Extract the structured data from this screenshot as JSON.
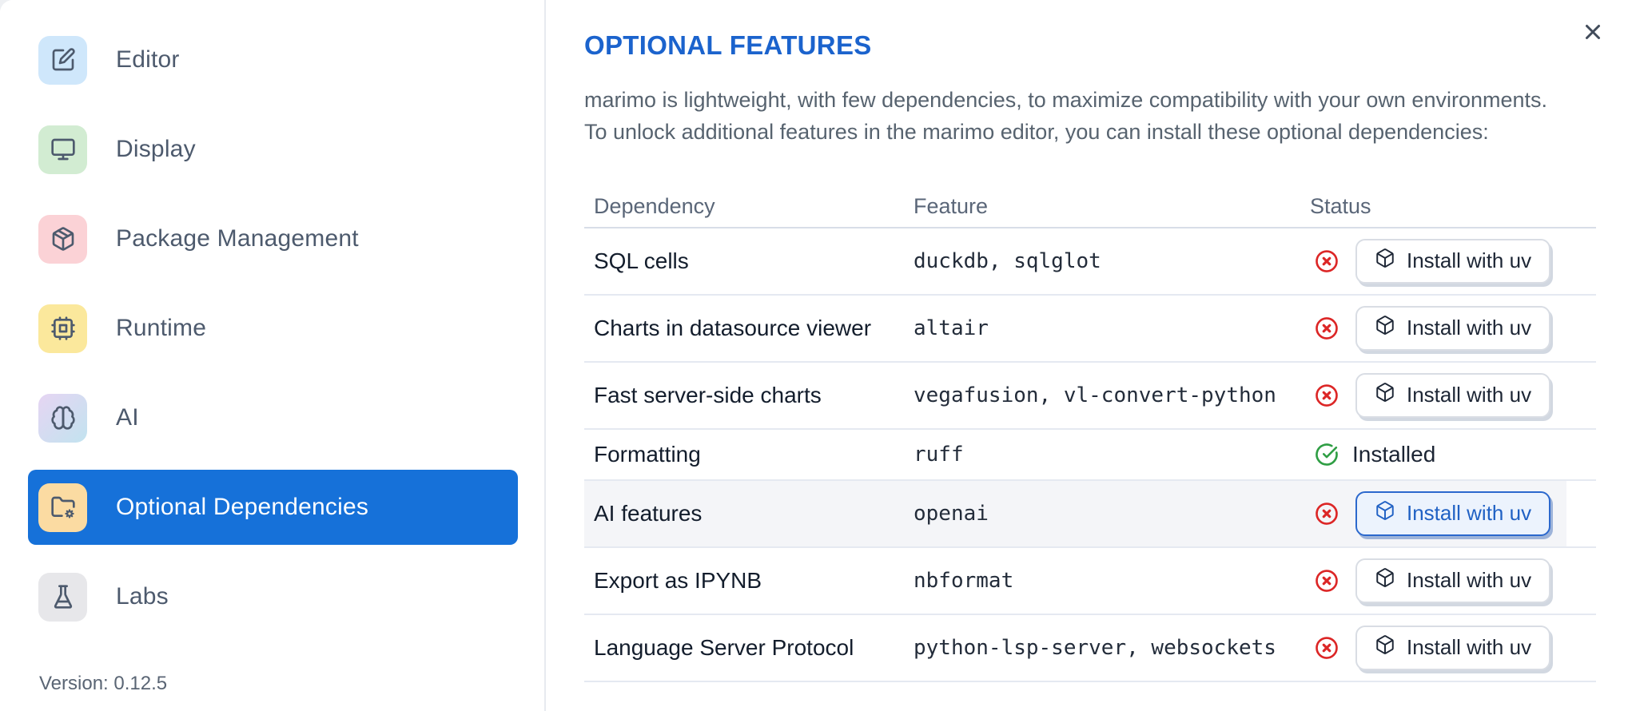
{
  "window": {
    "close_icon": "close-icon"
  },
  "sidebar": {
    "items": [
      {
        "label": "Editor",
        "icon": "edit-icon",
        "icon_bg": "#cfe7fb",
        "selected": false
      },
      {
        "label": "Display",
        "icon": "monitor-icon",
        "icon_bg": "#d2ecd2",
        "selected": false
      },
      {
        "label": "Package Management",
        "icon": "package-icon",
        "icon_bg": "#fbd2d6",
        "selected": false
      },
      {
        "label": "Runtime",
        "icon": "cpu-icon",
        "icon_bg": "#fbe89c",
        "selected": false
      },
      {
        "label": "AI",
        "icon": "brain-icon",
        "icon_bg": "linear-gradient(135deg,#e6d5f3,#c2e3ef)",
        "selected": false
      },
      {
        "label": "Optional Dependencies",
        "icon": "folder-cog-icon",
        "icon_bg": "#fbdba2",
        "selected": true
      },
      {
        "label": "Labs",
        "icon": "flask-icon",
        "icon_bg": "#e7e7ea",
        "selected": false
      }
    ],
    "version": "Version: 0.12.5"
  },
  "main": {
    "title": "OPTIONAL FEATURES",
    "description_line1": "marimo is lightweight, with few dependencies, to maximize compatibility with your own environments.",
    "description_line2": "To unlock additional features in the marimo editor, you can install these optional dependencies:",
    "table": {
      "headers": [
        "Dependency",
        "Feature",
        "Status"
      ],
      "install_button_label": "Install with uv",
      "installed_label": "Installed",
      "rows": [
        {
          "dependency": "SQL cells",
          "feature": "duckdb, sqlglot",
          "status": "not-installed",
          "action": "Install with uv",
          "highlighted": false
        },
        {
          "dependency": "Charts in datasource viewer",
          "feature": "altair",
          "status": "not-installed",
          "action": "Install with uv",
          "highlighted": false
        },
        {
          "dependency": "Fast server-side charts",
          "feature": "vegafusion, vl-convert-python",
          "status": "not-installed",
          "action": "Install with uv",
          "highlighted": false
        },
        {
          "dependency": "Formatting",
          "feature": "ruff",
          "status": "installed",
          "status_label": "Installed",
          "highlighted": false
        },
        {
          "dependency": "AI features",
          "feature": "openai",
          "status": "not-installed",
          "action": "Install with uv",
          "highlighted": true
        },
        {
          "dependency": "Export as IPYNB",
          "feature": "nbformat",
          "status": "not-installed",
          "action": "Install with uv",
          "highlighted": false
        },
        {
          "dependency": "Language Server Protocol",
          "feature": "python-lsp-server, websockets",
          "status": "not-installed",
          "action": "Install with uv",
          "highlighted": false
        }
      ]
    }
  },
  "colors": {
    "accent_blue": "#1671d9",
    "title_blue": "#1b63cd",
    "status_error_red": "#dc2626",
    "status_success_green": "#2f9e44",
    "row_highlight": "#f4f5f8",
    "divider": "#e5e9f1"
  }
}
